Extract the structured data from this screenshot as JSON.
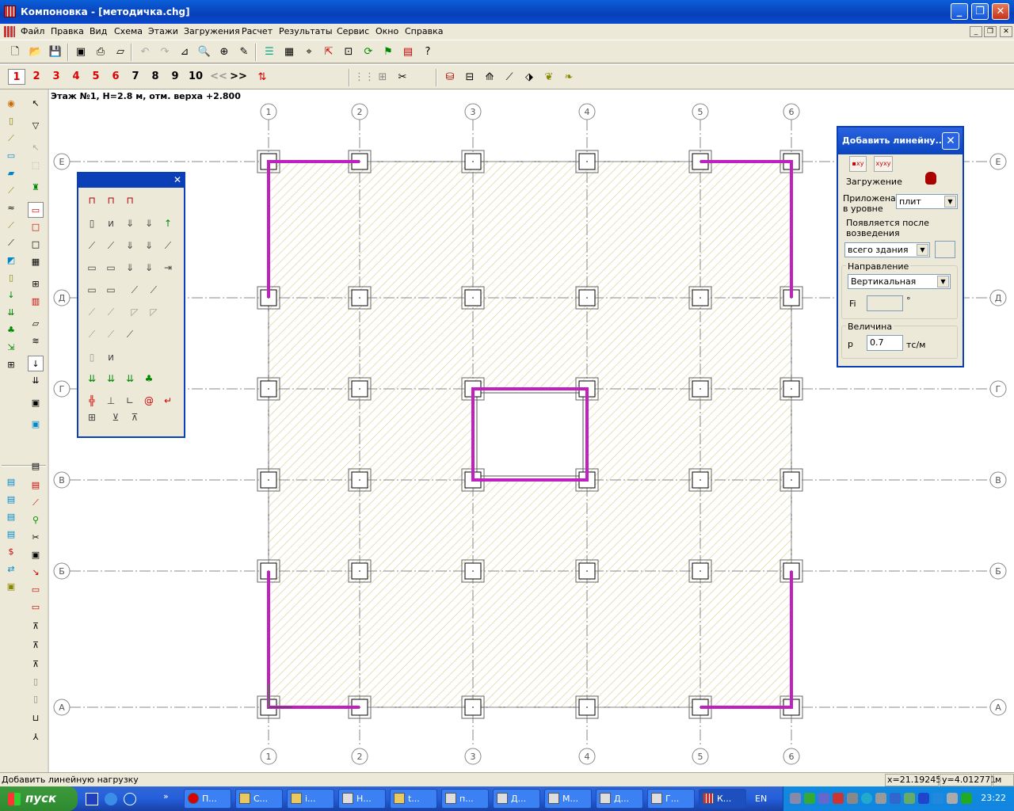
{
  "window": {
    "title": "Компоновка - [методичка.chg]"
  },
  "menu": [
    "Файл",
    "Правка",
    "Вид",
    "Схема",
    "Этажи",
    "Загружения",
    "Расчет",
    "Результаты",
    "Сервис",
    "Окно",
    "Справка"
  ],
  "floors": {
    "numbers": [
      "1",
      "2",
      "3",
      "4",
      "5",
      "6",
      "7",
      "8",
      "9",
      "10"
    ],
    "prev": "<<",
    "next": ">>"
  },
  "canvas": {
    "floor_label": "Этаж №1, H=2.8 м, отм. верха +2.800",
    "axes_x": [
      "1",
      "2",
      "3",
      "4",
      "5",
      "6"
    ],
    "axes_y": [
      "Е",
      "Д",
      "Г",
      "В",
      "Б",
      "А"
    ]
  },
  "dialog": {
    "title": "Добавить линейну...",
    "load_case_label": "Загружение",
    "applied_label": "Приложена в уровне",
    "applied_value": "плит",
    "appears_label": "Появляется после возведения",
    "appears_value": "всего здания",
    "direction_label": "Направление",
    "direction_value": "Вертикальная",
    "fi_label": "Fi",
    "fi_unit": "°",
    "magnitude_label": "Величина",
    "p_label": "p",
    "p_value": "0.7",
    "p_unit": "тс/м"
  },
  "status": {
    "hint": "Добавить линейную нагрузку",
    "x": "x=21.19245",
    "y": "y=4.012771",
    "unit": "м"
  },
  "taskbar": {
    "start": "пуск",
    "tasks": [
      "П...",
      "С...",
      "i...",
      "Н...",
      "t...",
      "п...",
      "Д...",
      "М...",
      "Д...",
      "Г...",
      "К..."
    ],
    "lang": "EN",
    "clock": "23:22"
  },
  "colors": {
    "load_line": "#c020c0",
    "slab_hatch": "#d8cc88",
    "title_blue": "#0a44c0"
  }
}
